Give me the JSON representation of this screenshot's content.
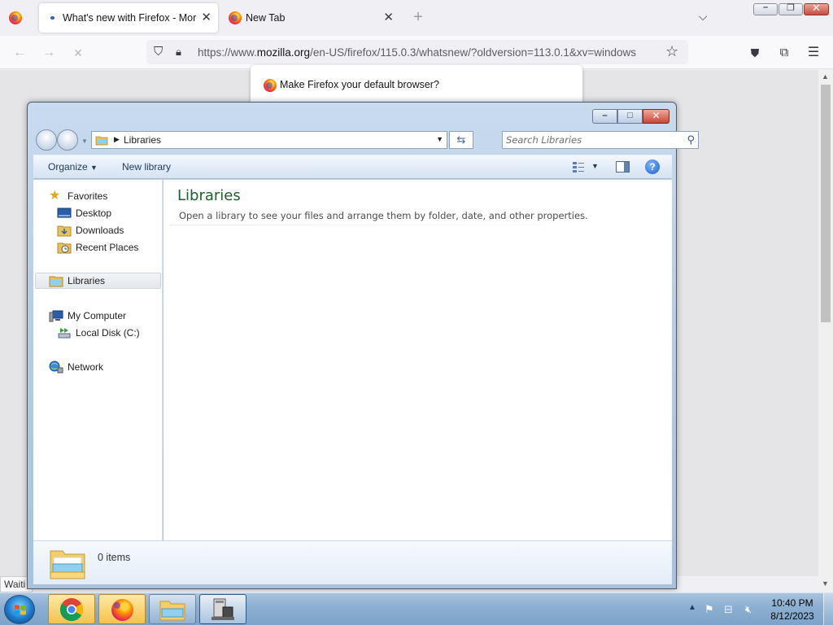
{
  "firefox": {
    "tabs": [
      {
        "title": "What's new with Firefox - More",
        "active": true
      },
      {
        "title": "New Tab",
        "active": false
      }
    ],
    "url_prefix": "https://www.",
    "url_domain": "mozilla.org",
    "url_rest": "/en-US/firefox/115.0.3/whatsnew/?oldversion=113.0.1&xv=windows",
    "default_prompt": "Make Firefox your default browser?",
    "status_text": "Waiti"
  },
  "explorer": {
    "breadcrumb": "Libraries",
    "search_placeholder": "Search Libraries",
    "toolbar": {
      "organize_label": "Organize",
      "new_library_label": "New library"
    },
    "nav": {
      "favorites": "Favorites",
      "desktop": "Desktop",
      "downloads": "Downloads",
      "recent_places": "Recent Places",
      "libraries": "Libraries",
      "my_computer": "My Computer",
      "local_disk": "Local Disk (C:)",
      "network": "Network"
    },
    "main": {
      "title": "Libraries",
      "description": "Open a library to see your files and arrange them by folder, date, and other properties."
    },
    "status": {
      "item_count": "0 items"
    }
  },
  "taskbar": {
    "apps": [
      "chrome-icon",
      "firefox-icon",
      "explorer-icon",
      "installer-icon"
    ],
    "clock_time": "10:40 PM",
    "clock_date": "8/12/2023"
  },
  "colors": {
    "library_title": "#1e5e2c",
    "taskbar": "#8db0d2",
    "explorer_frame": "#b9cde4"
  }
}
